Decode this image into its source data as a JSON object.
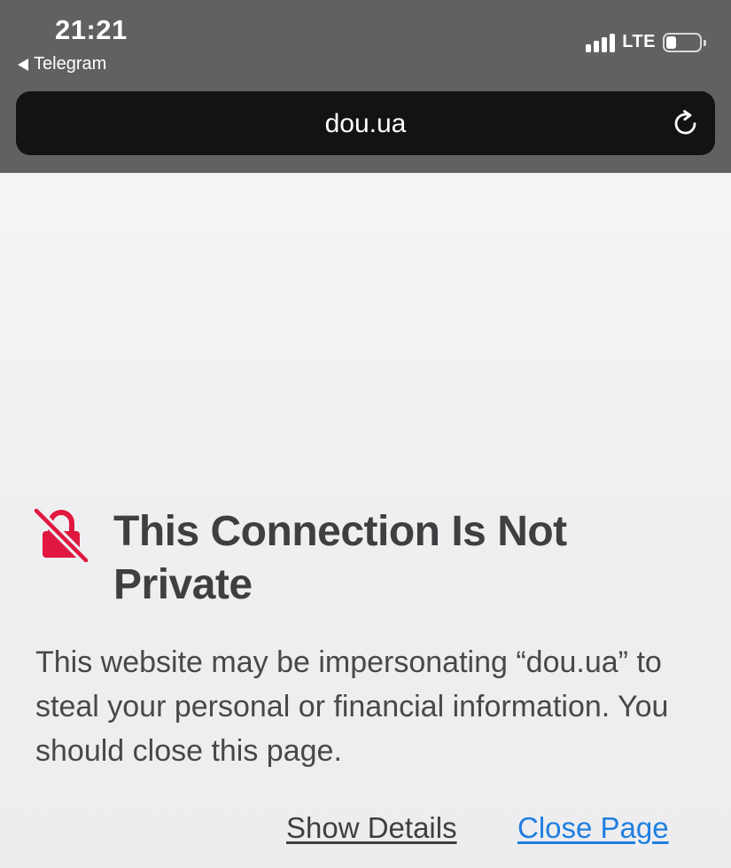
{
  "status_bar": {
    "time": "21:21",
    "back_app_label": "Telegram",
    "network": "LTE",
    "signal_bars": 4,
    "battery_level": 0.3,
    "icons": [
      "back-arrow-icon",
      "signal-icon",
      "battery-icon"
    ]
  },
  "address_bar": {
    "url": "dou.ua",
    "reload_icon": "reload-icon"
  },
  "warning": {
    "icon": "broken-lock-icon",
    "icon_color": "#e0173f",
    "title": "This Connection Is Not Private",
    "message": "This website may be impersonating “dou.ua” to steal your personal or financial information. You should close this page."
  },
  "actions": {
    "show_details": "Show Details",
    "close_page": "Close Page",
    "link_color": "#1f7fe0"
  }
}
